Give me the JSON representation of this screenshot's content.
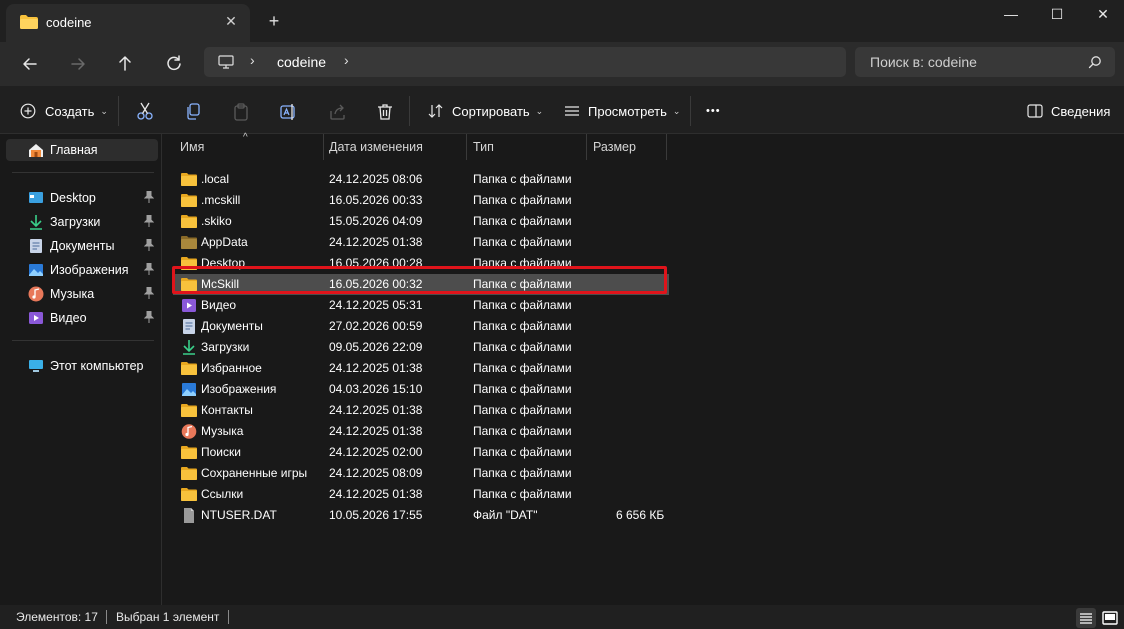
{
  "window": {
    "tab_title": "codeine",
    "new_tab_label": "+",
    "minimize_label": "—",
    "maximize_label": "☐",
    "close_label": "✕",
    "tab_close_label": "✕"
  },
  "navigation": {
    "address_parts": [
      "codeine"
    ],
    "search_placeholder": "Поиск в: codeine"
  },
  "toolbar": {
    "create_label": "Создать",
    "sort_label": "Сортировать",
    "view_label": "Просмотреть",
    "more_label": "•••",
    "details_label": "Сведения"
  },
  "sidebar": {
    "home_label": "Главная",
    "quick_access": [
      {
        "label": "Desktop",
        "icon": "desktop-icon"
      },
      {
        "label": "Загрузки",
        "icon": "download-icon"
      },
      {
        "label": "Документы",
        "icon": "document-icon"
      },
      {
        "label": "Изображения",
        "icon": "image-icon"
      },
      {
        "label": "Музыка",
        "icon": "music-icon"
      },
      {
        "label": "Видео",
        "icon": "video-icon"
      }
    ],
    "this_pc_label": "Этот компьютер"
  },
  "columns": {
    "name": "Имя",
    "date": "Дата изменения",
    "type": "Тип",
    "size": "Размер"
  },
  "files": [
    {
      "name": ".local",
      "date": "24.12.2025 08:06",
      "type": "Папка с файлами",
      "size": "",
      "icon": "folder"
    },
    {
      "name": ".mcskill",
      "date": "16.05.2026 00:33",
      "type": "Папка с файлами",
      "size": "",
      "icon": "folder"
    },
    {
      "name": ".skiko",
      "date": "15.05.2026 04:09",
      "type": "Папка с файлами",
      "size": "",
      "icon": "folder"
    },
    {
      "name": "AppData",
      "date": "24.12.2025 01:38",
      "type": "Папка с файлами",
      "size": "",
      "icon": "folder-dim"
    },
    {
      "name": "Desktop",
      "date": "16.05.2026 00:28",
      "type": "Папка с файлами",
      "size": "",
      "icon": "folder"
    },
    {
      "name": "McSkill",
      "date": "16.05.2026 00:32",
      "type": "Папка с файлами",
      "size": "",
      "icon": "folder"
    },
    {
      "name": "Видео",
      "date": "24.12.2025 05:31",
      "type": "Папка с файлами",
      "size": "",
      "icon": "video"
    },
    {
      "name": "Документы",
      "date": "27.02.2026 00:59",
      "type": "Папка с файлами",
      "size": "",
      "icon": "document"
    },
    {
      "name": "Загрузки",
      "date": "09.05.2026 22:09",
      "type": "Папка с файлами",
      "size": "",
      "icon": "download"
    },
    {
      "name": "Избранное",
      "date": "24.12.2025 01:38",
      "type": "Папка с файлами",
      "size": "",
      "icon": "folder"
    },
    {
      "name": "Изображения",
      "date": "04.03.2026 15:10",
      "type": "Папка с файлами",
      "size": "",
      "icon": "image"
    },
    {
      "name": "Контакты",
      "date": "24.12.2025 01:38",
      "type": "Папка с файлами",
      "size": "",
      "icon": "folder"
    },
    {
      "name": "Музыка",
      "date": "24.12.2025 01:38",
      "type": "Папка с файлами",
      "size": "",
      "icon": "music"
    },
    {
      "name": "Поиски",
      "date": "24.12.2025 02:00",
      "type": "Папка с файлами",
      "size": "",
      "icon": "folder"
    },
    {
      "name": "Сохраненные игры",
      "date": "24.12.2025 08:09",
      "type": "Папка с файлами",
      "size": "",
      "icon": "folder"
    },
    {
      "name": "Ссылки",
      "date": "24.12.2025 01:38",
      "type": "Папка с файлами",
      "size": "",
      "icon": "folder"
    },
    {
      "name": "NTUSER.DAT",
      "date": "10.05.2026 17:55",
      "type": "Файл \"DAT\"",
      "size": "6 656 КБ",
      "icon": "file"
    }
  ],
  "selected_file": "McSkill",
  "status": {
    "items_count": "Элементов: 17",
    "selected_count": "Выбран 1 элемент"
  },
  "colors": {
    "accent_highlight": "#e0141b",
    "folder_yellow": "#f8c23c",
    "background": "#191919"
  }
}
